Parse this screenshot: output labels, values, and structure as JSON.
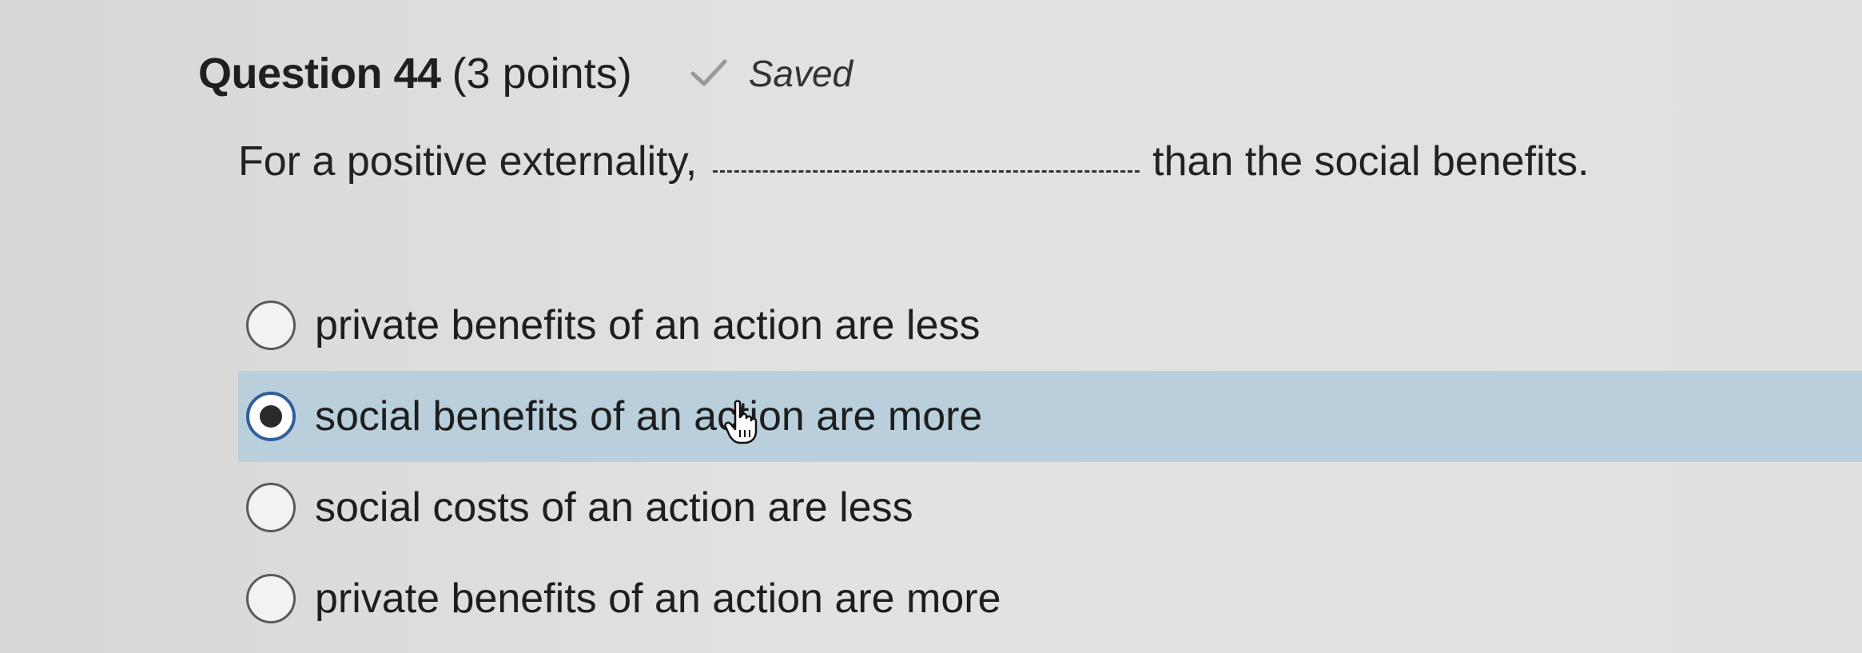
{
  "question": {
    "number_label": "Question 44",
    "points_label": "(3 points)",
    "status_label": "Saved",
    "status_icon": "check-icon",
    "prompt_before": "For a positive externality,",
    "prompt_after": "than the social benefits."
  },
  "options": [
    {
      "label": "private benefits of an action are less",
      "selected": false
    },
    {
      "label": "social benefits of an action are more",
      "selected": true
    },
    {
      "label": "social costs of an action are less",
      "selected": false
    },
    {
      "label": "private benefits of an action are more",
      "selected": false
    }
  ],
  "colors": {
    "background": "#dedfde",
    "selected_row": "#b9d0dc",
    "radio_checked_ring": "#2f5e9b"
  },
  "cursor_icon": "hand-pointer-icon"
}
